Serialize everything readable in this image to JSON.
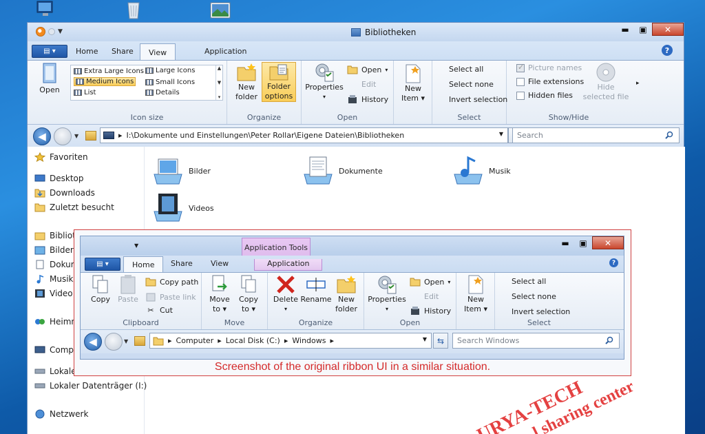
{
  "window": {
    "title": "Bibliotheken"
  },
  "tabs": {
    "home": "Home",
    "share": "Share",
    "view": "View",
    "application": "Application"
  },
  "ribbon": {
    "open_btn": "Open",
    "layout": {
      "extra_large": "Extra Large Icons",
      "large": "Large Icons",
      "medium": "Medium Icons",
      "small": "Small Icons",
      "list": "List",
      "details": "Details",
      "group_label": "Icon size"
    },
    "organize": {
      "new_folder_line1": "New",
      "new_folder_line2": "folder",
      "folder_options_line1": "Folder",
      "folder_options_line2": "options",
      "group_label": "Organize"
    },
    "open_group": {
      "properties": "Properties",
      "open": "Open",
      "edit": "Edit",
      "history": "History",
      "group_label": "Open"
    },
    "new_item_line1": "New",
    "new_item_line2": "Item",
    "select": {
      "select_all": "Select all",
      "select_none": "Select none",
      "invert": "Invert selection",
      "group_label": "Select"
    },
    "showhide": {
      "picture_names": "Picture names",
      "picture_names_checked": true,
      "file_extensions": "File extensions",
      "hidden_files": "Hidden files",
      "hide_selected_line1": "Hide",
      "hide_selected_line2": "selected file",
      "group_label": "Show/Hide"
    }
  },
  "address": {
    "path": "I:\\Dokumente und Einstellungen\\Peter Rollar\\Eigene Dateien\\Bibliotheken",
    "search_placeholder": "Search"
  },
  "navpane": {
    "favorites": "Favoriten",
    "desktop": "Desktop",
    "downloads": "Downloads",
    "recent": "Zuletzt besucht",
    "libraries": "Biblioth",
    "bilder": "Bilder",
    "dokumente": "Dokum",
    "musik": "Musik",
    "videos": "Video",
    "homegroup": "Heimne",
    "computer": "Compu",
    "local_disk": "Lokaler",
    "local_disk_i": "Lokaler Datenträger (I:)",
    "network": "Netzwerk"
  },
  "files": [
    {
      "label": "Bilder"
    },
    {
      "label": "Dokumente"
    },
    {
      "label": "Musik"
    },
    {
      "label": "Videos"
    }
  ],
  "inset": {
    "context_tab": "Application Tools",
    "tabs": {
      "home": "Home",
      "share": "Share",
      "view": "View",
      "application": "Application"
    },
    "clipboard": {
      "copy": "Copy",
      "paste": "Paste",
      "copy_path": "Copy path",
      "paste_link": "Paste link",
      "cut": "Cut",
      "group_label": "Clipboard"
    },
    "move": {
      "move_to_line1": "Move",
      "move_to_line2": "to",
      "copy_to_line1": "Copy",
      "copy_to_line2": "to",
      "group_label": "Move"
    },
    "organize": {
      "delete": "Delete",
      "rename": "Rename",
      "new_folder_line1": "New",
      "new_folder_line2": "folder",
      "group_label": "Organize"
    },
    "open_group": {
      "properties": "Properties",
      "open": "Open",
      "edit": "Edit",
      "history": "History",
      "group_label": "Open"
    },
    "new_item_line1": "New",
    "new_item_line2": "Item",
    "select": {
      "select_all": "Select all",
      "select_none": "Select none",
      "invert": "Invert selection",
      "group_label": "Select"
    },
    "address": {
      "computer": "Computer",
      "local_disk": "Local Disk (C:)",
      "windows": "Windows",
      "search_placeholder": "Search Windows"
    },
    "caption": "Screenshot of the original ribbon UI in a similar situation."
  },
  "watermark": {
    "line1": "URYA-TECH",
    "line2": "l sharing center"
  },
  "colors": {
    "accent": "#2d6ac2",
    "highlight": "#f9cd58",
    "caption_red": "#d42a2a",
    "context_tab": "#d8b3ea"
  }
}
